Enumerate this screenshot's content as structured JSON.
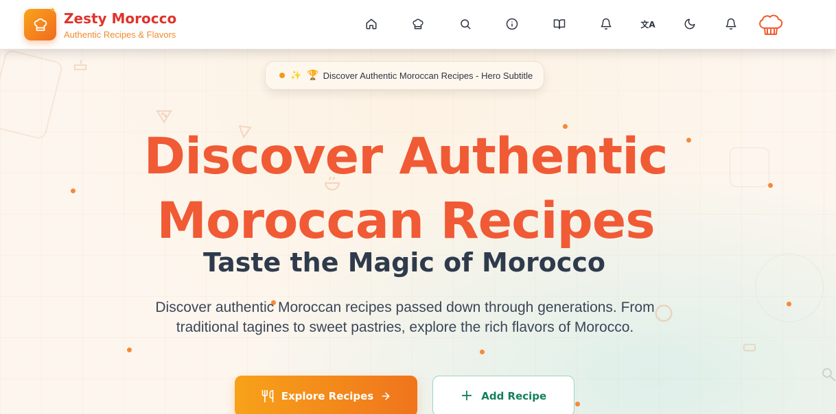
{
  "brand": {
    "title": "Zesty Morocco",
    "subtitle": "Authentic Recipes & Flavors",
    "logo_icon": "chef-hat-icon"
  },
  "nav": {
    "items": [
      {
        "icon": "home-icon"
      },
      {
        "icon": "chef-hat-icon"
      },
      {
        "icon": "search-icon"
      },
      {
        "icon": "info-icon"
      },
      {
        "icon": "book-open-icon"
      },
      {
        "icon": "bell-icon"
      },
      {
        "icon": "translate-icon",
        "glyph": "文A"
      },
      {
        "icon": "moon-icon"
      },
      {
        "icon": "notification-bell-icon"
      }
    ],
    "avatar_icon": "chef-hat-avatar-icon"
  },
  "hero": {
    "badge_text": "Discover Authentic Moroccan Recipes - Hero Subtitle",
    "badge_trophy": "🏆",
    "title_line1": "Discover Authentic",
    "title_line2": "Moroccan Recipes",
    "subtitle": "Taste the Magic of Morocco",
    "description": "Discover authentic Moroccan recipes passed down through generations. From traditional tagines to sweet pastries, explore the rich flavors of Morocco.",
    "primary_button": "Explore Recipes",
    "secondary_button": "Add Recipe"
  },
  "colors": {
    "brand_red": "#e0332b",
    "brand_orange": "#f08a2c",
    "hero_title": "#f05a35",
    "subtitle": "#2f3b4c",
    "secondary_green": "#12805c"
  }
}
